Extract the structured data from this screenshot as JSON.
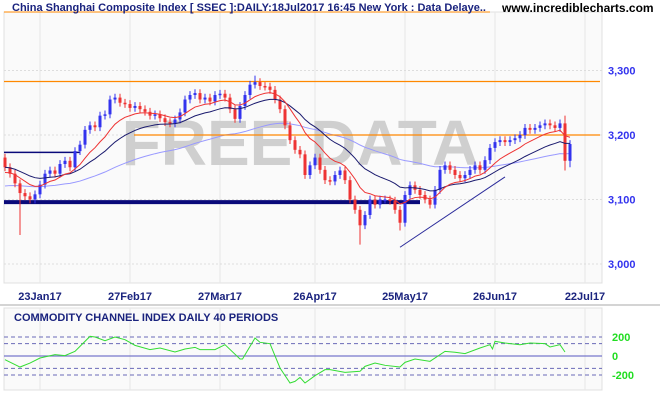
{
  "header": {
    "title": "China Shanghai Composite Index [ SSEC ]:DAILY:18Jul2017 16:45 New York : Data Delaye..",
    "site": "www.incrediblecharts.com",
    "watermark": "FREE DATA"
  },
  "colors": {
    "up": "#3333ee",
    "down": "#ee3333",
    "ema_short": "#ee3333",
    "ema_mid": "#1a1a6e",
    "ma_long": "#9999ff",
    "resistance": "#ff8800",
    "support": "#0a0a7a",
    "cci": "#33dd33"
  },
  "chart_data": [
    {
      "type": "candlestick",
      "title": "China Shanghai Composite Index [ SSEC ]:DAILY",
      "ylim": [
        2960,
        3330
      ],
      "yticks": [
        {
          "v": 3300,
          "label": "3,300"
        },
        {
          "v": 3200,
          "label": "3,200"
        },
        {
          "v": 3100,
          "label": "3,100"
        },
        {
          "v": 3000,
          "label": "3,000"
        }
      ],
      "xticks": [
        {
          "i": 7,
          "label": "23Jan17"
        },
        {
          "i": 25,
          "label": "27Feb17"
        },
        {
          "i": 43,
          "label": "27Mar17"
        },
        {
          "i": 62,
          "label": "26Apr17"
        },
        {
          "i": 80,
          "label": "25May17"
        },
        {
          "i": 98,
          "label": "26Jun17"
        },
        {
          "i": 116,
          "label": "22Jul17"
        }
      ],
      "first_open": 3165,
      "close": [
        3150,
        3140,
        3125,
        3110,
        3105,
        3100,
        3108,
        3123,
        3140,
        3145,
        3140,
        3155,
        3160,
        3150,
        3175,
        3185,
        3208,
        3215,
        3212,
        3230,
        3232,
        3255,
        3258,
        3250,
        3248,
        3242,
        3245,
        3240,
        3236,
        3230,
        3232,
        3226,
        3220,
        3218,
        3224,
        3235,
        3255,
        3262,
        3265,
        3255,
        3258,
        3252,
        3262,
        3264,
        3258,
        3240,
        3225,
        3245,
        3262,
        3278,
        3282,
        3276,
        3275,
        3270,
        3255,
        3240,
        3215,
        3192,
        3177,
        3170,
        3138,
        3153,
        3165,
        3146,
        3130,
        3128,
        3138,
        3145,
        3130,
        3100,
        3084,
        3060,
        3076,
        3100,
        3092,
        3100,
        3100,
        3098,
        3084,
        3064,
        3107,
        3122,
        3115,
        3107,
        3100,
        3092,
        3115,
        3146,
        3153,
        3146,
        3138,
        3133,
        3138,
        3146,
        3153,
        3146,
        3161,
        3180,
        3189,
        3192,
        3189,
        3192,
        3195,
        3200,
        3211,
        3208,
        3211,
        3215,
        3218,
        3215,
        3211,
        3218,
        3160,
        3186
      ],
      "long_wicks": [
        {
          "i": 3,
          "low": 3045
        },
        {
          "i": 71,
          "low": 3030
        },
        {
          "i": 79,
          "low": 3052
        },
        {
          "i": 50,
          "high": 3292
        },
        {
          "i": 112,
          "high": 3230,
          "low": 3145
        },
        {
          "i": 113,
          "low": 3150
        }
      ],
      "lines": [
        {
          "name": "resistance-upper",
          "value": 3283,
          "from": 0,
          "to": 119
        },
        {
          "name": "resistance-lower",
          "value": 3200,
          "from": 26,
          "to": 119
        },
        {
          "name": "prior-level",
          "value": 3173,
          "from": 0,
          "to": 15
        },
        {
          "name": "support",
          "value": 3096,
          "from": 0,
          "to": 83
        }
      ],
      "trendline": {
        "from": {
          "i": 79,
          "v": 3026
        },
        "to": {
          "i": 100,
          "v": 3135
        }
      },
      "ma_periods": {
        "short": 10,
        "mid": 21,
        "long": 60
      }
    },
    {
      "type": "line",
      "title": "COMMODITY CHANNEL INDEX DAILY 40 PERIODS",
      "ylim": [
        -300,
        300
      ],
      "yticks": [
        {
          "v": 200,
          "label": "200"
        },
        {
          "v": 0,
          "label": "0"
        },
        {
          "v": -200,
          "label": "-200"
        }
      ],
      "bands": [
        200,
        130,
        -130,
        -200
      ],
      "points": [
        [
          0,
          -39
        ],
        [
          3,
          -116
        ],
        [
          5,
          -74
        ],
        [
          7,
          -21
        ],
        [
          10,
          14
        ],
        [
          12,
          4
        ],
        [
          14,
          49
        ],
        [
          17,
          207
        ],
        [
          18,
          200
        ],
        [
          20,
          161
        ],
        [
          22,
          200
        ],
        [
          24,
          172
        ],
        [
          26,
          112
        ],
        [
          29,
          67
        ],
        [
          31,
          84
        ],
        [
          34,
          42
        ],
        [
          36,
          74
        ],
        [
          38,
          91
        ],
        [
          39,
          67
        ],
        [
          42,
          67
        ],
        [
          44,
          119
        ],
        [
          47,
          -32
        ],
        [
          47.5,
          -32
        ],
        [
          50,
          189
        ],
        [
          51,
          144
        ],
        [
          53,
          130
        ],
        [
          55,
          -126
        ],
        [
          57,
          -284
        ],
        [
          58,
          -267
        ],
        [
          59,
          -225
        ],
        [
          60,
          -284
        ],
        [
          62,
          -207
        ],
        [
          64,
          -144
        ],
        [
          65,
          -144
        ],
        [
          68,
          -172
        ],
        [
          71,
          -161
        ],
        [
          72,
          -109
        ],
        [
          74,
          -74
        ],
        [
          76,
          -98
        ],
        [
          79,
          -116
        ],
        [
          80,
          -67
        ],
        [
          82,
          -32
        ],
        [
          85,
          -56
        ],
        [
          88,
          49
        ],
        [
          90,
          39
        ],
        [
          92,
          25
        ],
        [
          95,
          84
        ],
        [
          97,
          119
        ],
        [
          97.5,
          74
        ],
        [
          98,
          154
        ],
        [
          100,
          137
        ],
        [
          103,
          119
        ],
        [
          105,
          137
        ],
        [
          108,
          130
        ],
        [
          109,
          95
        ],
        [
          111,
          119
        ],
        [
          112,
          42
        ]
      ]
    }
  ]
}
